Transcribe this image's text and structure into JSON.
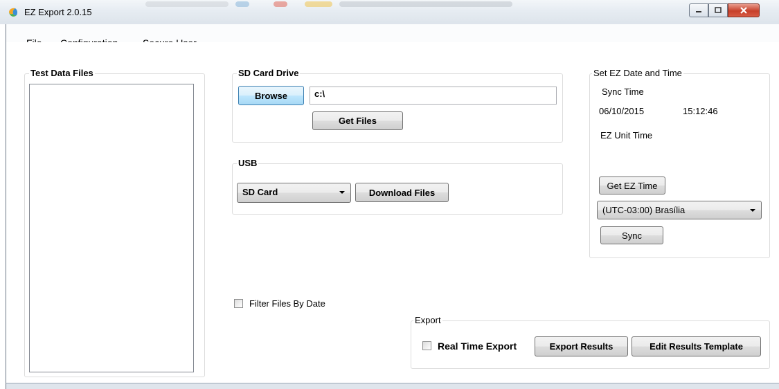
{
  "window": {
    "title": "EZ Export 2.0.15"
  },
  "menu": [
    "File",
    "Configuration",
    "Secure User"
  ],
  "test_data_files": {
    "title": "Test Data Files",
    "items": []
  },
  "sd_card": {
    "title": "SD Card Drive",
    "browse_label": "Browse",
    "path_value": "c:\\",
    "get_files_label": "Get Files"
  },
  "usb": {
    "title": "USB",
    "selected": "SD Card",
    "download_label": "Download Files"
  },
  "datetime": {
    "title": "Set EZ Date and Time",
    "sync_time_label": "Sync Time",
    "date": "06/10/2015",
    "time": "15:12:46",
    "unit_time_label": "EZ Unit Time",
    "get_time_label": "Get EZ Time",
    "timezone": "(UTC-03:00) Brasília",
    "sync_label": "Sync"
  },
  "filter": {
    "label": "Filter Files By Date",
    "checked": false
  },
  "export": {
    "title": "Export",
    "realtime_label": "Real Time Export",
    "realtime_checked": false,
    "export_results_label": "Export Results",
    "edit_template_label": "Edit Results Template"
  }
}
